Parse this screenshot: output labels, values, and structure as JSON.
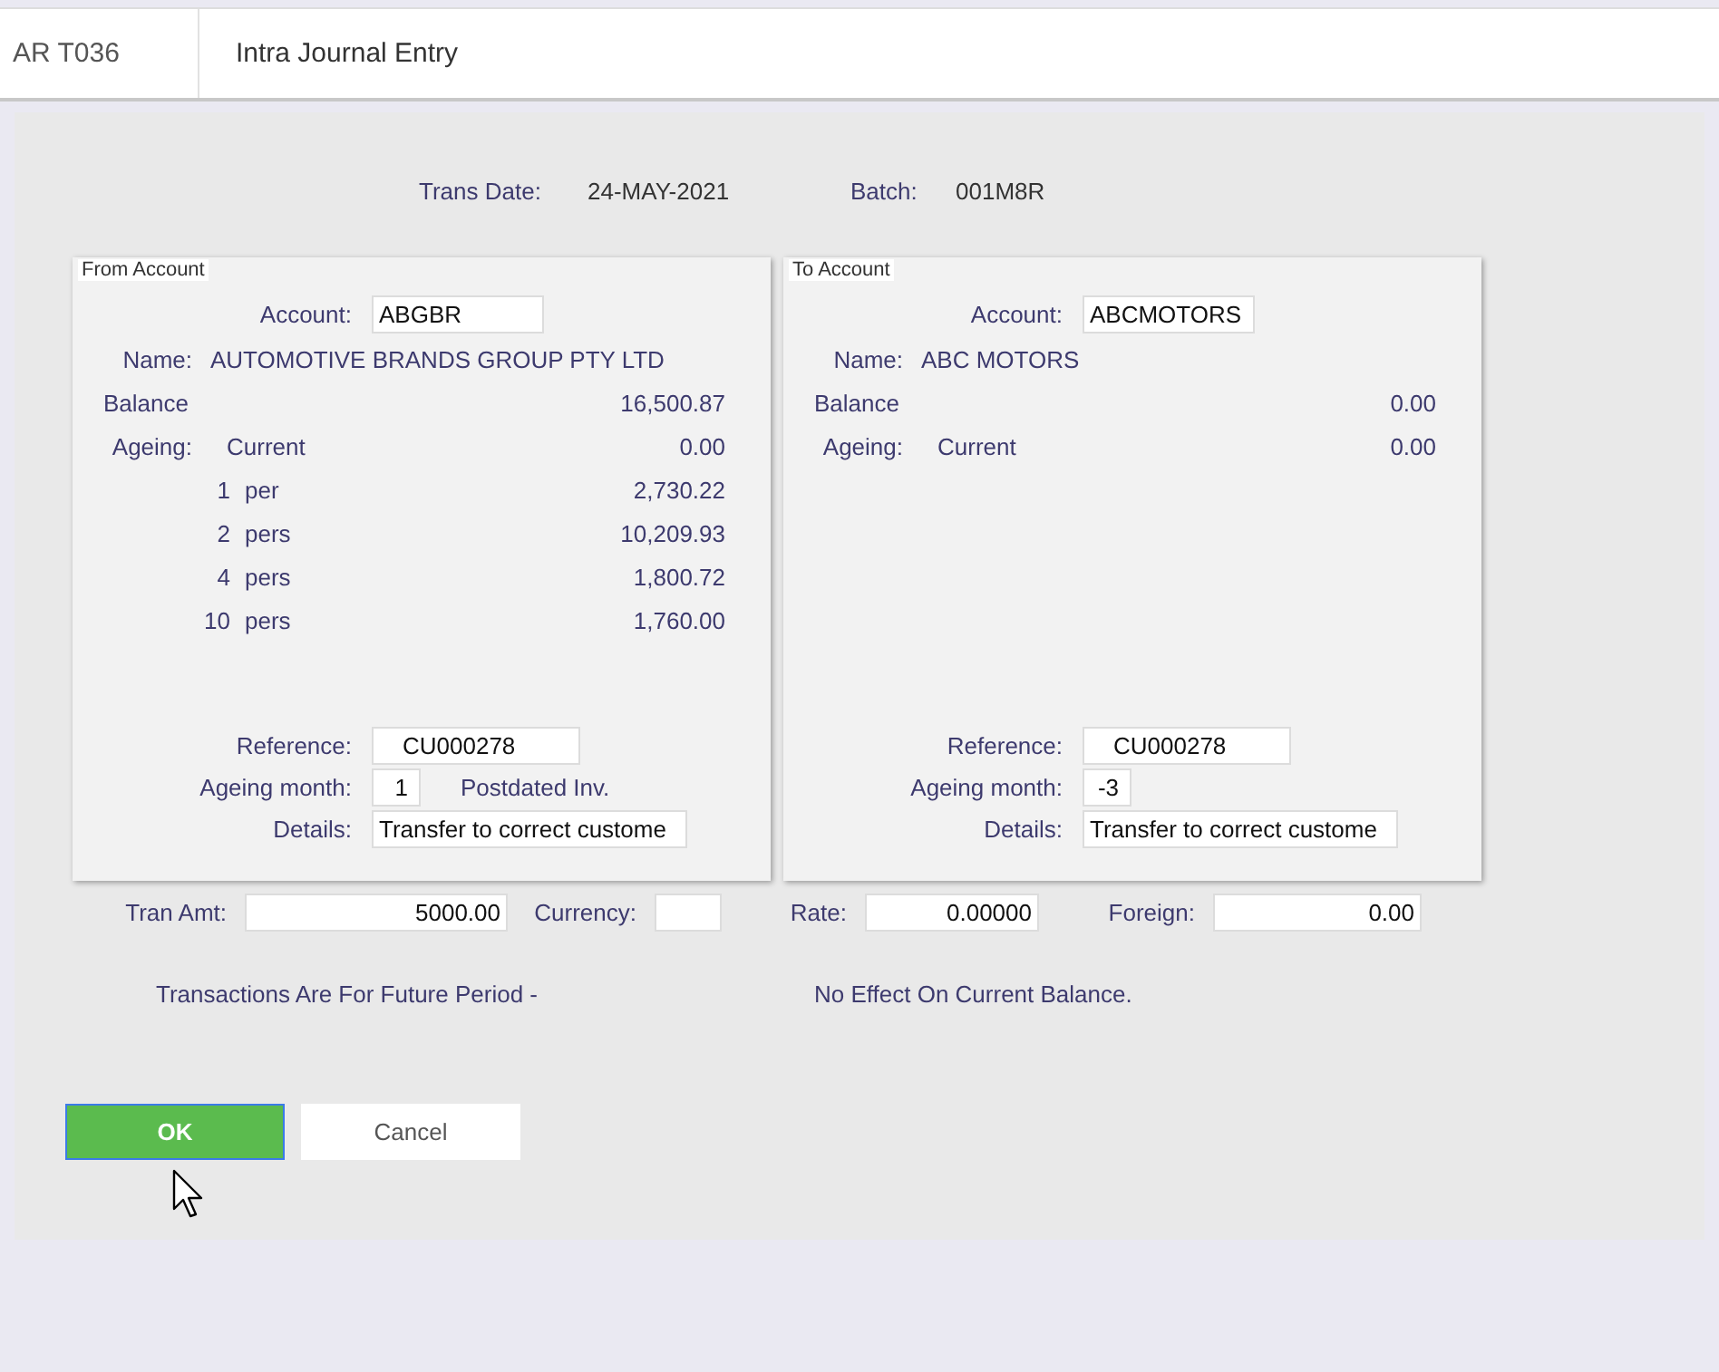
{
  "header": {
    "code": "AR T036",
    "title": "Intra Journal Entry"
  },
  "trans_date": {
    "label": "Trans Date:",
    "value": "24-MAY-2021"
  },
  "batch": {
    "label": "Batch:",
    "value": "001M8R"
  },
  "panels": [
    {
      "title": "From Account",
      "account_label": "Account:",
      "account": "ABGBR",
      "name_label": "Name:",
      "name": "AUTOMOTIVE BRANDS GROUP PTY LTD",
      "balance_label": "Balance",
      "balance": "16,500.87",
      "ageing_label": "Ageing:",
      "current_label": "Current",
      "current": "0.00",
      "buckets": [
        {
          "count": "1",
          "unit": "per",
          "amount": "2,730.22"
        },
        {
          "count": "2",
          "unit": "pers",
          "amount": "10,209.93"
        },
        {
          "count": "4",
          "unit": "pers",
          "amount": "1,800.72"
        },
        {
          "count": "10",
          "unit": "pers",
          "amount": "1,760.00"
        }
      ],
      "reference_label": "Reference:",
      "reference": "CU000278",
      "month_label": "Ageing month:",
      "month": "1",
      "month_note": "Postdated Inv.",
      "details_label": "Details:",
      "details": "Transfer to correct custome"
    },
    {
      "title": "To Account",
      "account_label": "Account:",
      "account": "ABCMOTORS",
      "name_label": "Name:",
      "name": "ABC MOTORS",
      "balance_label": "Balance",
      "balance": "0.00",
      "ageing_label": "Ageing:",
      "current_label": "Current",
      "current": "0.00",
      "reference_label": "Reference:",
      "reference": "CU000278",
      "month_label": "Ageing month:",
      "month": "-3",
      "details_label": "Details:",
      "details": "Transfer to correct custome"
    }
  ],
  "amount_fields": [
    {
      "label": "Tran Amt:",
      "value": "5000.00"
    },
    {
      "label": "Currency:"
    },
    {
      "label": "Rate:",
      "value": "0.00000"
    },
    {
      "label": "Foreign:",
      "value": "0.00"
    }
  ],
  "messages": [
    "Transactions Are For Future Period -",
    "No Effect On Current Balance."
  ],
  "buttons": [
    {
      "label": "OK",
      "kind": "primary",
      "focused": true
    },
    {
      "label": "Cancel",
      "kind": "secondary",
      "focused": false
    }
  ]
}
